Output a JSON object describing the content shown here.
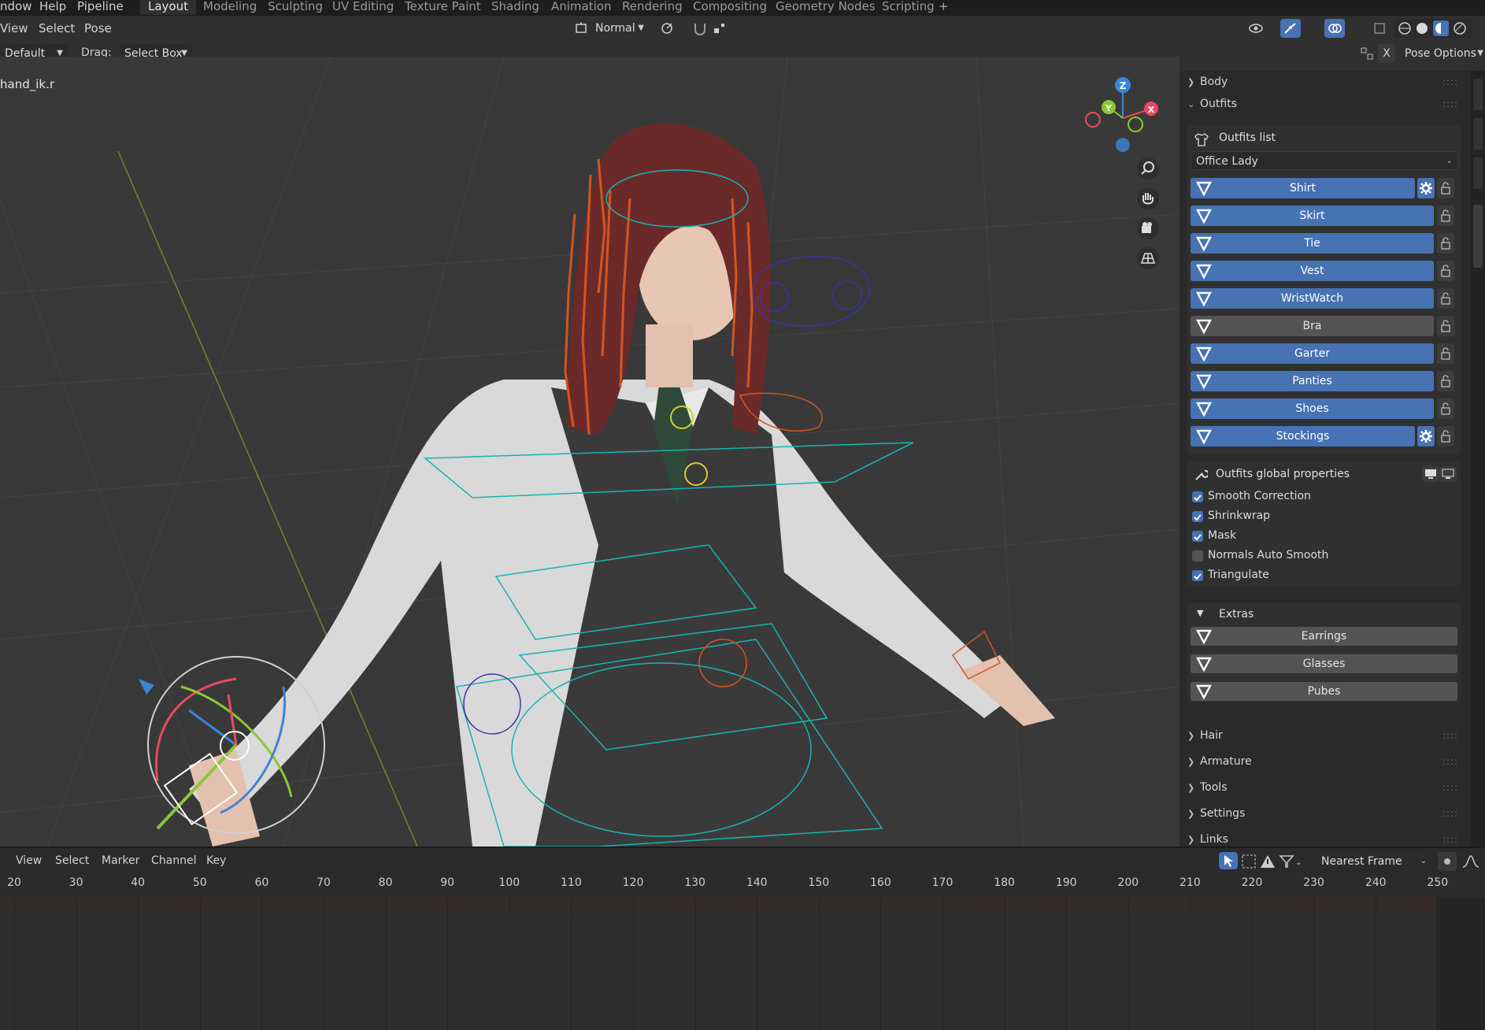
{
  "menubar": {
    "items": [
      "ndow",
      "Help",
      "Pipeline"
    ],
    "workspaces": [
      "Layout",
      "Modeling",
      "Sculpting",
      "UV Editing",
      "Texture Paint",
      "Shading",
      "Animation",
      "Rendering",
      "Compositing",
      "Geometry Nodes",
      "Scripting"
    ],
    "active_workspace": "Layout",
    "add_tab": "+"
  },
  "viewport_header": {
    "menus": [
      "View",
      "Select",
      "Pose"
    ],
    "mode": "Normal",
    "keying": "Default",
    "drag_label": "Drag:",
    "drag_value": "Select Box",
    "pose_options": "Pose Options",
    "x_label": "X"
  },
  "viewport": {
    "active_bone": "hand_ik.r",
    "gizmo_axes": [
      "Z",
      "Y",
      "X"
    ],
    "colors": {
      "x_axis": "#e84a5f",
      "y_axis": "#8ac832",
      "z_axis": "#3c85d6",
      "bones": "#d4551f",
      "selection": "#18b3b3"
    }
  },
  "npanel": {
    "sections_top": [
      {
        "label": "Body",
        "expanded": false
      },
      {
        "label": "Outfits",
        "expanded": true
      }
    ],
    "outfits_list_label": "Outfits list",
    "outfit_selected": "Office Lady",
    "outfits": [
      {
        "label": "Shirt",
        "on": true,
        "gear": true
      },
      {
        "label": "Skirt",
        "on": true,
        "gear": false
      },
      {
        "label": "Tie",
        "on": true,
        "gear": false
      },
      {
        "label": "Vest",
        "on": true,
        "gear": false
      },
      {
        "label": "WristWatch",
        "on": true,
        "gear": false
      },
      {
        "label": "Bra",
        "on": false,
        "gear": false
      },
      {
        "label": "Garter",
        "on": true,
        "gear": false
      },
      {
        "label": "Panties",
        "on": true,
        "gear": false
      },
      {
        "label": "Shoes",
        "on": true,
        "gear": false
      },
      {
        "label": "Stockings",
        "on": true,
        "gear": true
      }
    ],
    "global_props_label": "Outfits global properties",
    "global_props": [
      {
        "label": "Smooth Correction",
        "checked": true
      },
      {
        "label": "Shrinkwrap",
        "checked": true
      },
      {
        "label": "Mask",
        "checked": true
      },
      {
        "label": "Normals Auto Smooth",
        "checked": false
      },
      {
        "label": "Triangulate",
        "checked": true
      }
    ],
    "extras_label": "Extras",
    "extras": [
      "Earrings",
      "Glasses",
      "Pubes"
    ],
    "sections_bottom": [
      "Hair",
      "Armature",
      "Tools",
      "Settings",
      "Links"
    ]
  },
  "timeline": {
    "menus": [
      "View",
      "Select",
      "Marker",
      "Channel",
      "Key"
    ],
    "snap": "Nearest Frame",
    "ticks": [
      "20",
      "30",
      "40",
      "50",
      "60",
      "70",
      "80",
      "90",
      "100",
      "110",
      "120",
      "130",
      "140",
      "150",
      "160",
      "170",
      "180",
      "190",
      "200",
      "210",
      "220",
      "230",
      "240",
      "250"
    ]
  },
  "accent": "#4772b3"
}
